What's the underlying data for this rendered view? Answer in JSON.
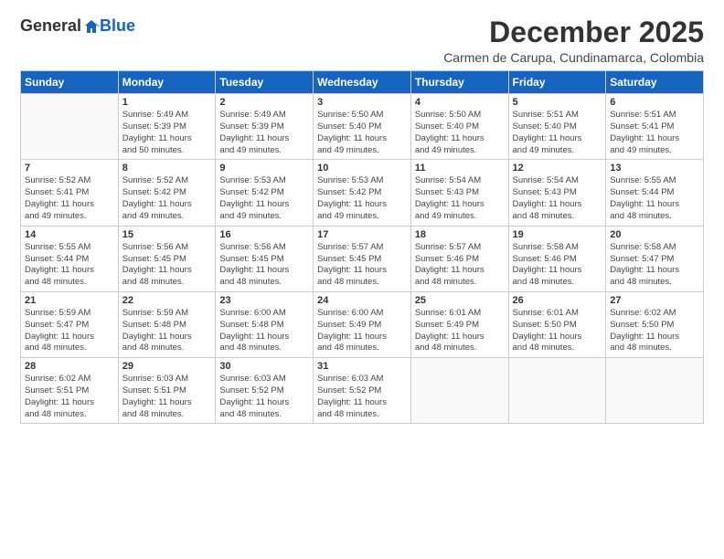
{
  "logo": {
    "general": "General",
    "blue": "Blue"
  },
  "title": "December 2025",
  "subtitle": "Carmen de Carupa, Cundinamarca, Colombia",
  "days_header": [
    "Sunday",
    "Monday",
    "Tuesday",
    "Wednesday",
    "Thursday",
    "Friday",
    "Saturday"
  ],
  "weeks": [
    [
      {
        "day": "",
        "sunrise": "",
        "sunset": "",
        "daylight": ""
      },
      {
        "day": "1",
        "sunrise": "Sunrise: 5:49 AM",
        "sunset": "Sunset: 5:39 PM",
        "daylight": "Daylight: 11 hours and 50 minutes."
      },
      {
        "day": "2",
        "sunrise": "Sunrise: 5:49 AM",
        "sunset": "Sunset: 5:39 PM",
        "daylight": "Daylight: 11 hours and 49 minutes."
      },
      {
        "day": "3",
        "sunrise": "Sunrise: 5:50 AM",
        "sunset": "Sunset: 5:40 PM",
        "daylight": "Daylight: 11 hours and 49 minutes."
      },
      {
        "day": "4",
        "sunrise": "Sunrise: 5:50 AM",
        "sunset": "Sunset: 5:40 PM",
        "daylight": "Daylight: 11 hours and 49 minutes."
      },
      {
        "day": "5",
        "sunrise": "Sunrise: 5:51 AM",
        "sunset": "Sunset: 5:40 PM",
        "daylight": "Daylight: 11 hours and 49 minutes."
      },
      {
        "day": "6",
        "sunrise": "Sunrise: 5:51 AM",
        "sunset": "Sunset: 5:41 PM",
        "daylight": "Daylight: 11 hours and 49 minutes."
      }
    ],
    [
      {
        "day": "7",
        "sunrise": "Sunrise: 5:52 AM",
        "sunset": "Sunset: 5:41 PM",
        "daylight": "Daylight: 11 hours and 49 minutes."
      },
      {
        "day": "8",
        "sunrise": "Sunrise: 5:52 AM",
        "sunset": "Sunset: 5:42 PM",
        "daylight": "Daylight: 11 hours and 49 minutes."
      },
      {
        "day": "9",
        "sunrise": "Sunrise: 5:53 AM",
        "sunset": "Sunset: 5:42 PM",
        "daylight": "Daylight: 11 hours and 49 minutes."
      },
      {
        "day": "10",
        "sunrise": "Sunrise: 5:53 AM",
        "sunset": "Sunset: 5:42 PM",
        "daylight": "Daylight: 11 hours and 49 minutes."
      },
      {
        "day": "11",
        "sunrise": "Sunrise: 5:54 AM",
        "sunset": "Sunset: 5:43 PM",
        "daylight": "Daylight: 11 hours and 49 minutes."
      },
      {
        "day": "12",
        "sunrise": "Sunrise: 5:54 AM",
        "sunset": "Sunset: 5:43 PM",
        "daylight": "Daylight: 11 hours and 48 minutes."
      },
      {
        "day": "13",
        "sunrise": "Sunrise: 5:55 AM",
        "sunset": "Sunset: 5:44 PM",
        "daylight": "Daylight: 11 hours and 48 minutes."
      }
    ],
    [
      {
        "day": "14",
        "sunrise": "Sunrise: 5:55 AM",
        "sunset": "Sunset: 5:44 PM",
        "daylight": "Daylight: 11 hours and 48 minutes."
      },
      {
        "day": "15",
        "sunrise": "Sunrise: 5:56 AM",
        "sunset": "Sunset: 5:45 PM",
        "daylight": "Daylight: 11 hours and 48 minutes."
      },
      {
        "day": "16",
        "sunrise": "Sunrise: 5:56 AM",
        "sunset": "Sunset: 5:45 PM",
        "daylight": "Daylight: 11 hours and 48 minutes."
      },
      {
        "day": "17",
        "sunrise": "Sunrise: 5:57 AM",
        "sunset": "Sunset: 5:45 PM",
        "daylight": "Daylight: 11 hours and 48 minutes."
      },
      {
        "day": "18",
        "sunrise": "Sunrise: 5:57 AM",
        "sunset": "Sunset: 5:46 PM",
        "daylight": "Daylight: 11 hours and 48 minutes."
      },
      {
        "day": "19",
        "sunrise": "Sunrise: 5:58 AM",
        "sunset": "Sunset: 5:46 PM",
        "daylight": "Daylight: 11 hours and 48 minutes."
      },
      {
        "day": "20",
        "sunrise": "Sunrise: 5:58 AM",
        "sunset": "Sunset: 5:47 PM",
        "daylight": "Daylight: 11 hours and 48 minutes."
      }
    ],
    [
      {
        "day": "21",
        "sunrise": "Sunrise: 5:59 AM",
        "sunset": "Sunset: 5:47 PM",
        "daylight": "Daylight: 11 hours and 48 minutes."
      },
      {
        "day": "22",
        "sunrise": "Sunrise: 5:59 AM",
        "sunset": "Sunset: 5:48 PM",
        "daylight": "Daylight: 11 hours and 48 minutes."
      },
      {
        "day": "23",
        "sunrise": "Sunrise: 6:00 AM",
        "sunset": "Sunset: 5:48 PM",
        "daylight": "Daylight: 11 hours and 48 minutes."
      },
      {
        "day": "24",
        "sunrise": "Sunrise: 6:00 AM",
        "sunset": "Sunset: 5:49 PM",
        "daylight": "Daylight: 11 hours and 48 minutes."
      },
      {
        "day": "25",
        "sunrise": "Sunrise: 6:01 AM",
        "sunset": "Sunset: 5:49 PM",
        "daylight": "Daylight: 11 hours and 48 minutes."
      },
      {
        "day": "26",
        "sunrise": "Sunrise: 6:01 AM",
        "sunset": "Sunset: 5:50 PM",
        "daylight": "Daylight: 11 hours and 48 minutes."
      },
      {
        "day": "27",
        "sunrise": "Sunrise: 6:02 AM",
        "sunset": "Sunset: 5:50 PM",
        "daylight": "Daylight: 11 hours and 48 minutes."
      }
    ],
    [
      {
        "day": "28",
        "sunrise": "Sunrise: 6:02 AM",
        "sunset": "Sunset: 5:51 PM",
        "daylight": "Daylight: 11 hours and 48 minutes."
      },
      {
        "day": "29",
        "sunrise": "Sunrise: 6:03 AM",
        "sunset": "Sunset: 5:51 PM",
        "daylight": "Daylight: 11 hours and 48 minutes."
      },
      {
        "day": "30",
        "sunrise": "Sunrise: 6:03 AM",
        "sunset": "Sunset: 5:52 PM",
        "daylight": "Daylight: 11 hours and 48 minutes."
      },
      {
        "day": "31",
        "sunrise": "Sunrise: 6:03 AM",
        "sunset": "Sunset: 5:52 PM",
        "daylight": "Daylight: 11 hours and 48 minutes."
      },
      {
        "day": "",
        "sunrise": "",
        "sunset": "",
        "daylight": ""
      },
      {
        "day": "",
        "sunrise": "",
        "sunset": "",
        "daylight": ""
      },
      {
        "day": "",
        "sunrise": "",
        "sunset": "",
        "daylight": ""
      }
    ]
  ]
}
